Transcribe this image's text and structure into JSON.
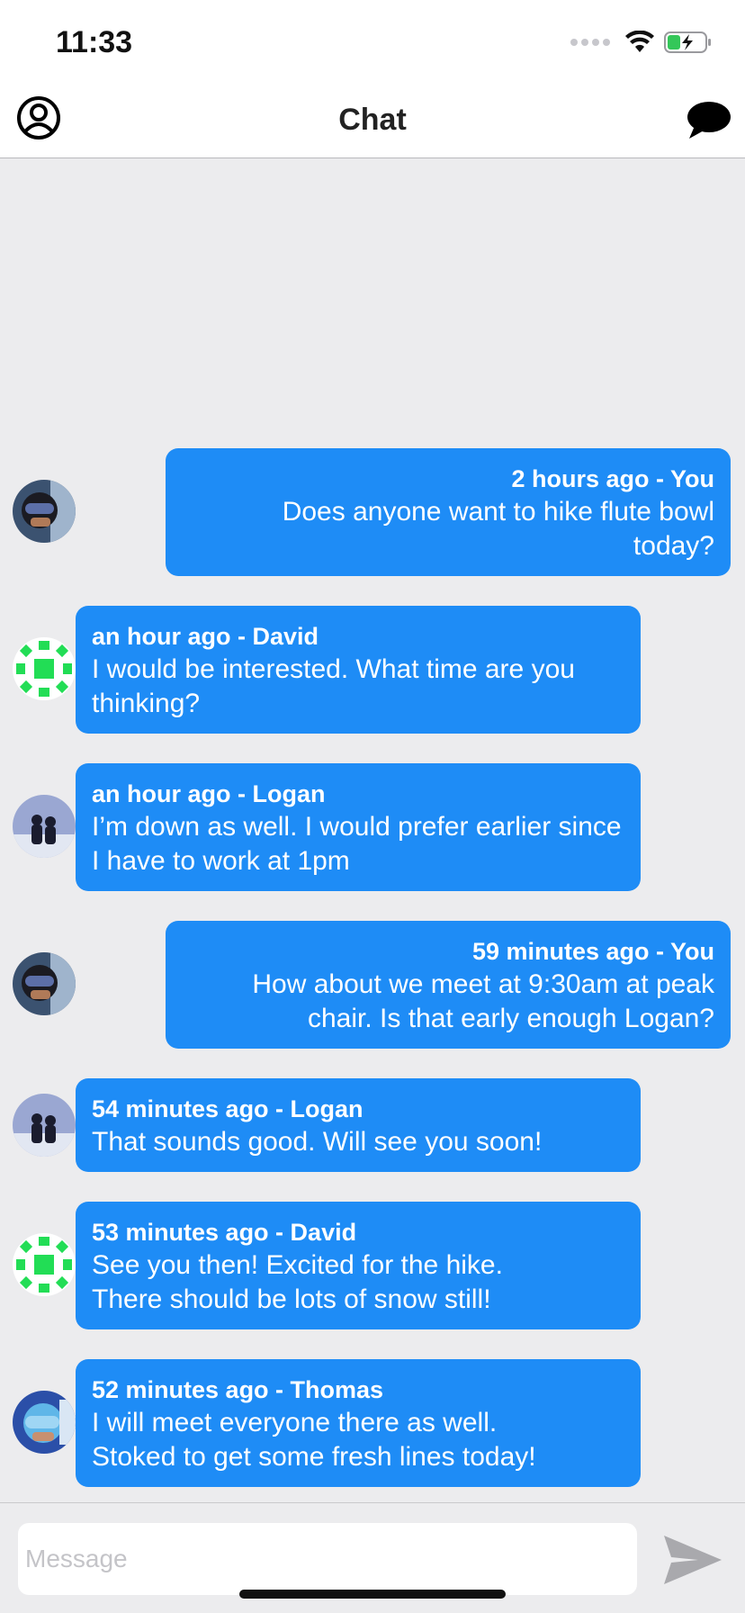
{
  "status_bar": {
    "time": "11:33",
    "wifi_icon": "wifi-icon",
    "battery_icon": "battery-charging-icon",
    "battery_color": "#34c759"
  },
  "nav": {
    "title": "Chat",
    "left_icon": "profile-icon",
    "right_icon": "chat-bubble-icon"
  },
  "colors": {
    "bubble": "#1e8cf6",
    "background": "#ececee",
    "send_icon": "#a9a9ad"
  },
  "messages": [
    {
      "meta": "2 hours ago - You",
      "text": "Does anyone want to hike flute bowl today?",
      "mine": true,
      "avatar": "avatar-you"
    },
    {
      "meta": "an hour ago - David",
      "text": "I would be interested.  What time are you thinking?",
      "mine": false,
      "avatar": "avatar-david"
    },
    {
      "meta": "an hour ago - Logan",
      "text": "I’m down as well.  I would prefer earlier since I have to work at 1pm",
      "mine": false,
      "avatar": "avatar-logan"
    },
    {
      "meta": "59 minutes ago - You",
      "text": "How about we meet at 9:30am at peak chair.  Is that early enough Logan?",
      "mine": true,
      "avatar": "avatar-you"
    },
    {
      "meta": "54 minutes ago - Logan",
      "text": "That sounds good.  Will see you soon!",
      "mine": false,
      "avatar": "avatar-logan"
    },
    {
      "meta": "53 minutes ago - David",
      "text": "See you then!  Excited for the hike. There should be lots of snow still!",
      "mine": false,
      "avatar": "avatar-david"
    },
    {
      "meta": "52 minutes ago - Thomas",
      "text": "I will meet everyone there as well. Stoked to get some fresh lines today!",
      "mine": false,
      "avatar": "avatar-thomas"
    }
  ],
  "composer": {
    "placeholder": "Message",
    "value": "",
    "send_icon": "send-icon"
  }
}
